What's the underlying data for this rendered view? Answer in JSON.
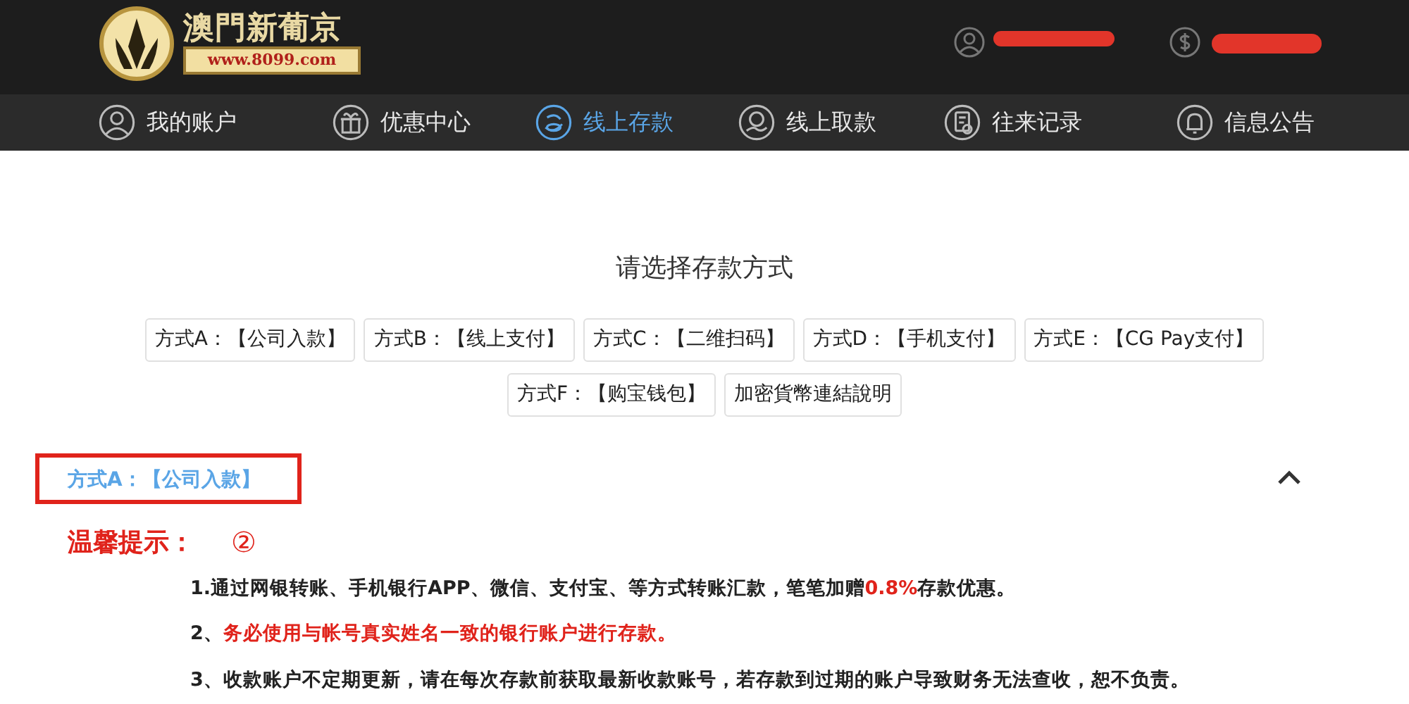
{
  "header": {
    "brand": "澳門新葡京",
    "site": "www.8099.com"
  },
  "nav": [
    {
      "label": "我的账户",
      "selected": false
    },
    {
      "label": "优惠中心",
      "selected": false
    },
    {
      "label": "线上存款",
      "selected": true
    },
    {
      "label": "线上取款",
      "selected": false
    },
    {
      "label": "往来记录",
      "selected": false
    },
    {
      "label": "信息公告",
      "selected": false
    }
  ],
  "title": "请选择存款方式",
  "methods": [
    "方式A：【公司入款】",
    "方式B：【线上支付】",
    "方式C：【二维扫码】",
    "方式D：【手机支付】",
    "方式E：【CG Pay支付】",
    "方式F：【购宝钱包】",
    "加密貨幣連結說明"
  ],
  "section": {
    "title": "方式A：【公司入款】",
    "expanded": true,
    "annotation": "②",
    "tips_title": "温馨提示：",
    "notes": [
      {
        "parts": [
          {
            "text": "1.通过网银转账、手机银行APP、微信、支付宝、等方式转账汇款，笔笔加赠",
            "emphasis": false
          },
          {
            "text": "0.8%",
            "emphasis": true
          },
          {
            "text": "存款优惠。",
            "emphasis": false
          }
        ]
      },
      {
        "parts": [
          {
            "text": "2、",
            "emphasis": false
          },
          {
            "text": "务必使用与帐号真实姓名一致的银行账户进行存款。",
            "emphasis": true
          }
        ]
      },
      {
        "parts": [
          {
            "text": "3、收款账户不定期更新，请在每次存款前获取最新收款账号，若存款到过期的账户导致财务无法查收，恕不负责。",
            "emphasis": false
          }
        ]
      }
    ]
  }
}
